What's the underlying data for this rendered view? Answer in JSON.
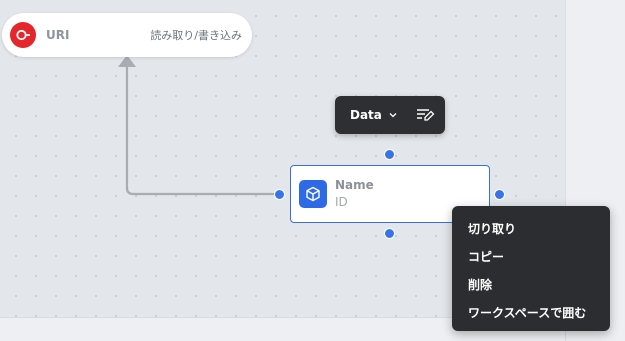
{
  "uri_node": {
    "name": "URI",
    "access": "読み取り/書き込み",
    "icon": "uri-circle-icon",
    "icon_color": "#e5262b"
  },
  "toolbar": {
    "type_label": "Data",
    "chevron_icon": "chevron-down-icon",
    "edit_icon": "edit-lines-icon"
  },
  "node": {
    "name": "Name",
    "id_label": "ID",
    "icon": "cube-icon",
    "icon_color": "#2f6ae6",
    "border_color": "#3b6fe0"
  },
  "context_menu": {
    "items": [
      {
        "label": "切り取り"
      },
      {
        "label": "コピー"
      },
      {
        "label": "削除"
      },
      {
        "label": "ワークスペースで囲む"
      }
    ]
  },
  "colors": {
    "canvas": "#e3e6ea",
    "handle": "#3a73e8",
    "connector": "#a9adb3",
    "menu_bg": "#2b2d31"
  }
}
